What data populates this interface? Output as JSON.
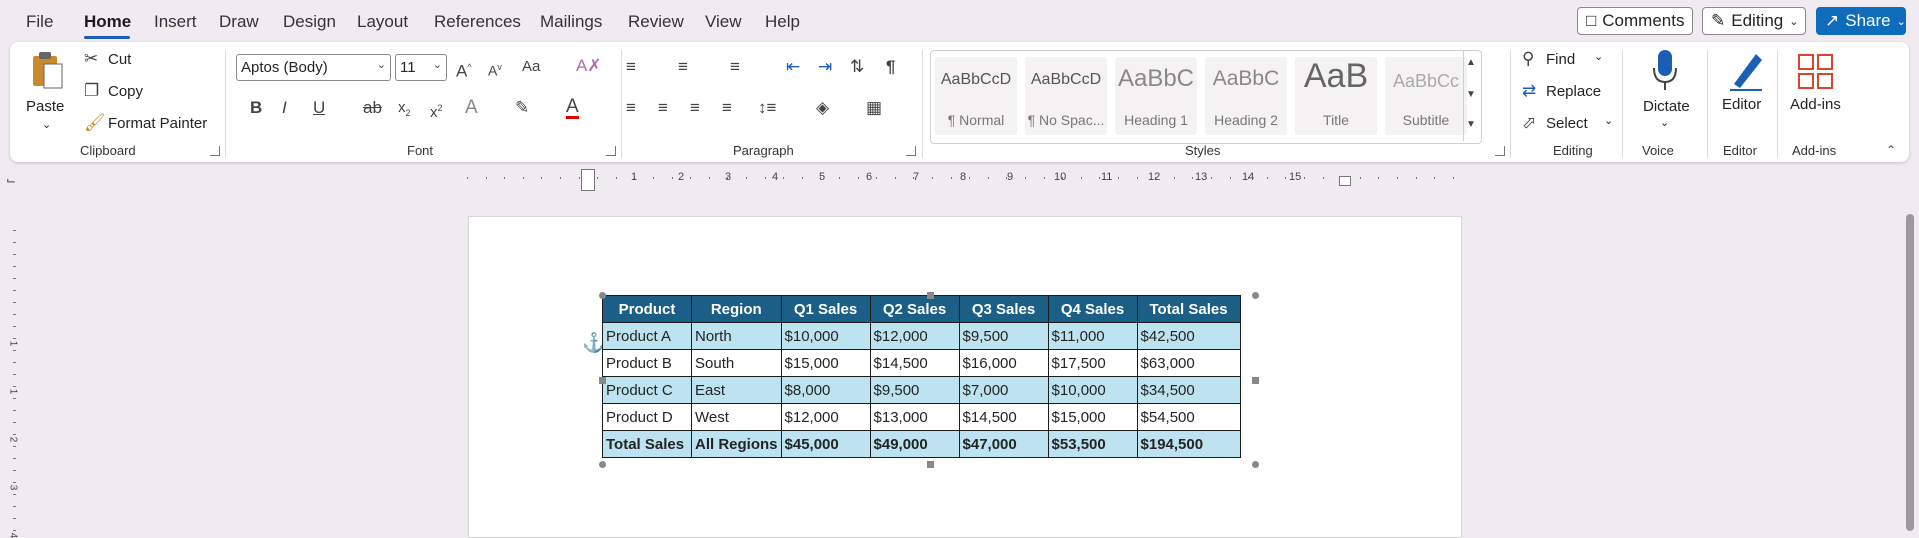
{
  "menu": {
    "tabs": [
      "File",
      "Home",
      "Insert",
      "Draw",
      "Design",
      "Layout",
      "References",
      "Mailings",
      "Review",
      "View",
      "Help"
    ],
    "active": "Home",
    "comments_label": "Comments",
    "editing_label": "Editing",
    "share_label": "Share"
  },
  "ribbon": {
    "clipboard": {
      "paste": "Paste",
      "cut": "Cut",
      "copy": "Copy",
      "format_painter": "Format Painter",
      "label": "Clipboard"
    },
    "font": {
      "name": "Aptos (Body)",
      "size": "11",
      "label": "Font"
    },
    "paragraph": {
      "label": "Paragraph"
    },
    "styles": {
      "label": "Styles",
      "items": [
        {
          "sample": "AaBbCcD",
          "name": "¶ Normal"
        },
        {
          "sample": "AaBbCcD",
          "name": "¶ No Spac..."
        },
        {
          "sample": "AaBbC",
          "name": "Heading 1"
        },
        {
          "sample": "AaBbC",
          "name": "Heading 2"
        },
        {
          "sample": "AaB",
          "name": "Title"
        },
        {
          "sample": "AaBbCc",
          "name": "Subtitle"
        }
      ]
    },
    "editing": {
      "find": "Find",
      "replace": "Replace",
      "select": "Select",
      "label": "Editing"
    },
    "voice": {
      "dictate": "Dictate",
      "label": "Voice"
    },
    "editor": {
      "editor": "Editor",
      "label": "Editor"
    },
    "addins": {
      "addins": "Add-ins",
      "label": "Add-ins"
    }
  },
  "ruler": {
    "h_numbers": [
      "1",
      "2",
      "3",
      "4",
      "5",
      "6",
      "7",
      "8",
      "9",
      "10",
      "11",
      "12",
      "13",
      "14",
      "15"
    ],
    "v_numbers": [
      "1",
      "1",
      "2",
      "3",
      "4"
    ]
  },
  "table": {
    "headers": [
      "Product",
      "Region",
      "Q1 Sales",
      "Q2 Sales",
      "Q3 Sales",
      "Q4 Sales",
      "Total Sales"
    ],
    "rows": [
      [
        "Product A",
        "North",
        "$10,000",
        "$12,000",
        "$9,500",
        "$11,000",
        "$42,500"
      ],
      [
        "Product B",
        "South",
        "$15,000",
        "$14,500",
        "$16,000",
        "$17,500",
        "$63,000"
      ],
      [
        "Product C",
        "East",
        "$8,000",
        "$9,500",
        "$7,000",
        "$10,000",
        "$34,500"
      ],
      [
        "Product D",
        "West",
        "$12,000",
        "$13,000",
        "$14,500",
        "$15,000",
        "$54,500"
      ]
    ],
    "total": [
      "Total Sales",
      "All Regions",
      "$45,000",
      "$49,000",
      "$47,000",
      "$53,500",
      "$194,500"
    ]
  },
  "colors": {
    "accent": "#0f6cbd",
    "table_header": "#1b5e86",
    "table_band": "#bde3f0"
  },
  "icons": [
    "cut-icon",
    "copy-icon",
    "format-painter-icon",
    "bold-icon",
    "italic-icon",
    "underline-icon",
    "find-icon",
    "replace-icon",
    "select-icon",
    "microphone-icon",
    "editor-icon",
    "addins-icon",
    "anchor-icon"
  ]
}
